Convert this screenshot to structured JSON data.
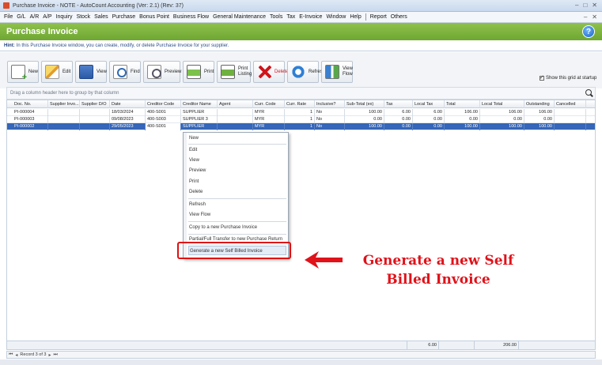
{
  "window": {
    "title": "Purchase Invoice - NOTE - AutoCount Accounting (Ver: 2.1) (Rev: 37)",
    "controls": [
      "–",
      "□",
      "✕"
    ]
  },
  "menu": {
    "items": [
      "File",
      "G/L",
      "A/R",
      "A/P",
      "Inquiry",
      "Stock",
      "Sales",
      "Purchase",
      "Bonus Point",
      "Business Flow",
      "General Maintenance",
      "Tools",
      "Tax",
      "E-Invoice",
      "Window",
      "Help",
      "Report",
      "Others"
    ]
  },
  "banner": {
    "title": "Purchase Invoice",
    "help": "?"
  },
  "hint": {
    "label": "Hint:",
    "text": "In this Purchase Invoice window, you can create, modify, or delete Purchase Invoice for your supplier."
  },
  "toolbar": {
    "new": "New",
    "edit": "Edit",
    "view": "View",
    "find": "Find",
    "preview": "Preview",
    "print": "Print",
    "print_listing": "Print Listing",
    "delete": "Delete",
    "refresh": "Refresh",
    "view_flow": "View Flow",
    "show_grid": "Show this grid at startup"
  },
  "groupbar": {
    "text": "Drag a column header here to group by that column"
  },
  "grid": {
    "columns": [
      "Doc. No.",
      "Supplier Invo...",
      "Supplier D/O",
      "Date",
      "Creditor Code",
      "Creditor Name",
      "Agent",
      "Curr. Code",
      "Curr. Rate",
      "Inclusive?",
      "Sub-Total (ex)",
      "Tax",
      "Local Tax",
      "Total",
      "Local Total",
      "Outstanding",
      "Cancelled"
    ],
    "rows": [
      [
        "PI-000004",
        "",
        "",
        "18/03/2024",
        "400-S001",
        "SUPPLIER",
        "",
        "MYR",
        "1",
        "No",
        "100.00",
        "6.00",
        "6.00",
        "106.00",
        "106.00",
        "106.00",
        ""
      ],
      [
        "PI-000003",
        "",
        "",
        "09/08/2023",
        "400-S003",
        "SUPPLIER 3",
        "",
        "MYR",
        "1",
        "No",
        "0.00",
        "0.00",
        "0.00",
        "0.00",
        "0.00",
        "0.00",
        ""
      ],
      [
        "PI-000002",
        "",
        "",
        "29/05/2023",
        "400-S001",
        "SUPPLIER",
        "",
        "MYR",
        "1",
        "No",
        "100.00",
        "0.00",
        "0.00",
        "100.00",
        "100.00",
        "100.00",
        ""
      ]
    ],
    "selected_row_indicator": "›",
    "footer_totals": {
      "local_tax": "6.00",
      "local_total": "206.00"
    }
  },
  "navigator": {
    "record_text": "Record 3 of 3"
  },
  "context_menu": {
    "items": [
      "New",
      "Edit",
      "View",
      "Preview",
      "Print",
      "Delete",
      "Refresh",
      "View Flow",
      "Copy to a new Purchase Invoice",
      "Partial/Full Transfer to new Purchase Return",
      "Generate a new Self Billed Invoice"
    ]
  },
  "annotation": {
    "line1": "Generate a new Self",
    "line2": "Billed Invoice",
    "color": "#e0121a"
  }
}
